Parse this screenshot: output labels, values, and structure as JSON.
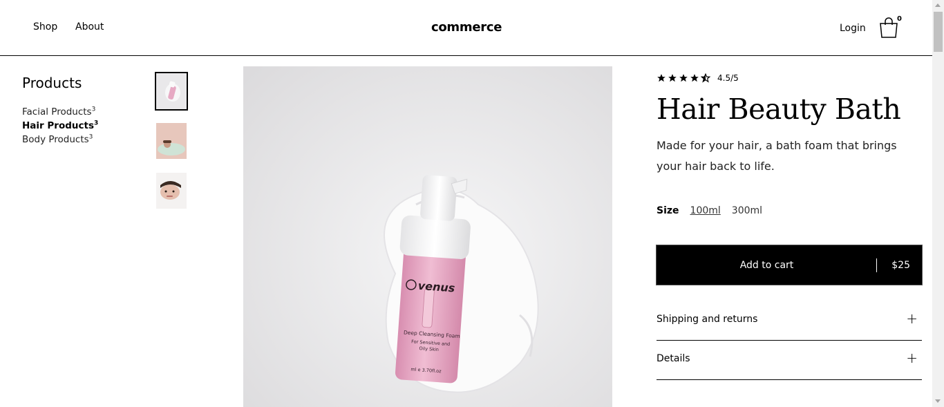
{
  "header": {
    "nav": [
      {
        "label": "Shop"
      },
      {
        "label": "About"
      }
    ],
    "logo": "commerce",
    "login_label": "Login",
    "cart_count": "0",
    "cart_icon": "shopping-bag-icon"
  },
  "sidebar": {
    "title": "Products",
    "categories": [
      {
        "label": "Facial Products",
        "count": "3",
        "active": false
      },
      {
        "label": "Hair Products",
        "count": "3",
        "active": true
      },
      {
        "label": "Body Products",
        "count": "3",
        "active": false
      }
    ]
  },
  "gallery": {
    "thumbnails": [
      "product-bottle",
      "model-in-bath",
      "model-face"
    ],
    "selected_index": 0,
    "main_image": "pink-foam-bottle-on-cream",
    "bottle_brand": "venus",
    "bottle_text_1": "Deep Cleansing Foam",
    "bottle_text_2": "For Sensitive and",
    "bottle_text_3": "Oily Skin",
    "bottle_volume": "ml e 3.70fl.oz"
  },
  "product": {
    "rating": 4.5,
    "rating_text": "4.5/5",
    "title": "Hair Beauty Bath",
    "description": "Made for your hair, a bath foam that brings your hair back to life.",
    "size_label": "Size",
    "sizes": [
      {
        "label": "100ml",
        "selected": true
      },
      {
        "label": "300ml",
        "selected": false
      }
    ],
    "add_to_cart_label": "Add to cart",
    "price": "$25",
    "accordions": [
      {
        "label": "Shipping and returns",
        "icon": "plus-icon"
      },
      {
        "label": "Details",
        "icon": "plus-icon"
      }
    ]
  },
  "colors": {
    "accent": "#000000",
    "background": "#ffffff",
    "bottle_pink": "#e8aac6"
  }
}
